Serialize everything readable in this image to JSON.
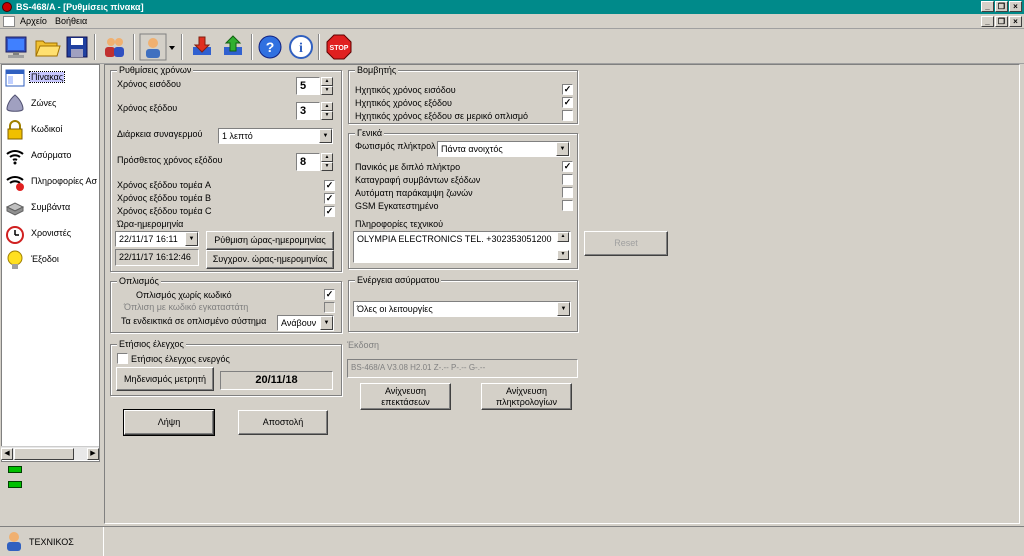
{
  "window": {
    "title": "BS-468/A - [Ρυθμίσεις πίνακα]",
    "min": "_",
    "restore": "❐",
    "close": "×"
  },
  "menu": {
    "file": "Αρχείο",
    "help": "Βοήθεια"
  },
  "toolbar": {
    "icons": [
      "computer-icon",
      "folder-open-icon",
      "save-icon",
      "users-icon",
      "user-settings-icon",
      "download-icon",
      "upload-icon",
      "help-icon",
      "info-icon",
      "stop-icon"
    ],
    "stop_label": "STOP"
  },
  "sidebar": {
    "items": [
      {
        "label": "Πίνακας",
        "icon": "panel-icon"
      },
      {
        "label": "Ζώνες",
        "icon": "zones-icon"
      },
      {
        "label": "Κωδικοί",
        "icon": "lock-icon"
      },
      {
        "label": "Ασύρματο",
        "icon": "wireless-icon"
      },
      {
        "label": "Πληροφορίες Ασ",
        "icon": "wireless-info-icon"
      },
      {
        "label": "Συμβάντα",
        "icon": "events-icon"
      },
      {
        "label": "Χρονιστές",
        "icon": "clock-icon"
      },
      {
        "label": "Έξοδοι",
        "icon": "bulb-icon"
      }
    ]
  },
  "status": {
    "user": "ΤΕΧΝΙΚΟΣ"
  },
  "timers": {
    "legend": "Ρυθμίσεις χρόνων",
    "entry_label": "Χρόνος εισόδου",
    "entry_value": "5",
    "exit_label": "Χρόνος εξόδου",
    "exit_value": "3",
    "alarm_label": "Διάρκεια συναγερμού",
    "alarm_value": "1 λεπτό",
    "extra_exit_label": "Πρόσθετος χρόνος εξόδου",
    "extra_exit_value": "8",
    "part_a": "Χρόνος εξόδου τομέα A",
    "part_b": "Χρόνος εξόδου τομέα B",
    "part_c": "Χρόνος εξόδου τομέα C",
    "datetime_label": "Ώρα-ημερομηνία",
    "datetime_value": "22/11/17  16:11",
    "datetime_readonly": "22/11/17   16:12:46",
    "set_datetime_btn": "Ρύθμιση ώρας-ημερομηνίας",
    "sync_datetime_btn": "Συγχρον. ώρας-ημερομηνίας"
  },
  "arming": {
    "legend": "Οπλισμός",
    "no_code": "Οπλισμός χωρίς κωδικό",
    "code_installer": "Όπλιση με κωδικό εγκαταστάτη",
    "indicators": "Τα ενδεικτικά σε οπλισμένο σύστημα",
    "indicators_value": "Ανάβουν"
  },
  "annual": {
    "legend": "Ετήσιος έλεγχος",
    "active": "Ετήσιος έλεγχος ενεργός",
    "reset_btn": "Μηδενισμός μετρητή",
    "date": "20/11/18"
  },
  "buzzer": {
    "legend": "Βομβητής",
    "entry": "Ηχητικός χρόνος εισόδου",
    "exit": "Ηχητικός χρόνος εξόδου",
    "exit_partial": "Ηχητικός χρόνος εξόδου σε μερικό οπλισμό"
  },
  "general": {
    "legend": "Γενικά",
    "keypad_light_label": "Φωτισμός πλήκτρολ",
    "keypad_light_value": "Πάντα ανοιχτός",
    "panic": "Πανικός με διπλό πλήκτρο",
    "log_exit": "Καταγραφή συμβάντων εξόδων",
    "auto_bypass": "Αυτόματη παράκαμψη ζωνών",
    "gsm": "GSM Εγκατεστημένο",
    "tech_info_label": "Πληροφορίες τεχνικού",
    "tech_info_value": "OLYMPIA ELECTRONICS   TEL. +302353051200"
  },
  "reset_btn": "Reset",
  "wireless_action": {
    "legend": "Ενέργεια ασύρματου",
    "value": "Όλες οι λειτουργίες"
  },
  "version": {
    "label": "Έκδοση",
    "value": "BS-468/A V3.08 H2.01 Z-.-- P-.-- G-.--"
  },
  "buttons": {
    "scan_ext": "Ανίχνευση επεκτάσεων",
    "scan_keypads": "Ανίχνευση πληκτρολογίων",
    "receive": "Λήψη",
    "send": "Αποστολή"
  },
  "colors": {
    "titlebar": "#008a8a",
    "face": "#d4d0c8",
    "status_green": "#00c000"
  }
}
